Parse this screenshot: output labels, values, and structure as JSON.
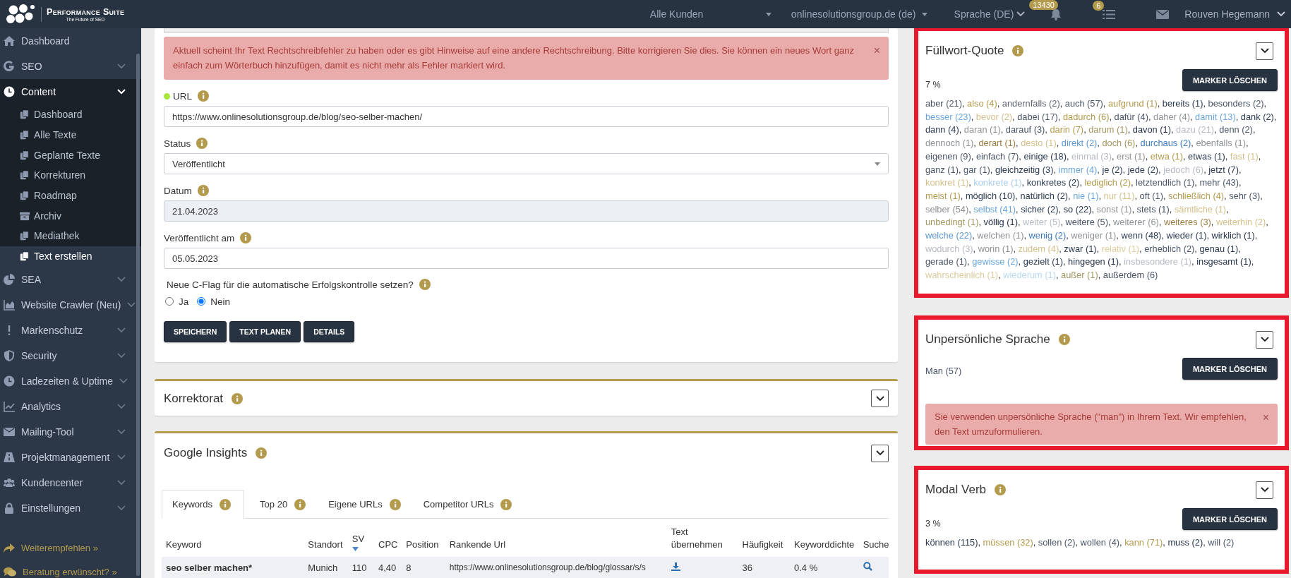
{
  "topbar": {
    "brand": "Performance Suite",
    "tagline": "The Future of SEO",
    "customer": "Alle Kunden",
    "domain": "onlinesolutionsgroup.de (de)",
    "language": "Sprache (DE)",
    "notifications_badge": "13430",
    "tasks_badge": "6",
    "user": "Rouven Hegemann"
  },
  "sidebar": {
    "items": [
      {
        "label": "Dashboard",
        "expandable": false,
        "expanded": false
      },
      {
        "label": "SEO",
        "expandable": true,
        "expanded": false
      },
      {
        "label": "Content",
        "expandable": true,
        "expanded": true,
        "children": [
          {
            "label": "Dashboard",
            "selected": false
          },
          {
            "label": "Alle Texte",
            "selected": false
          },
          {
            "label": "Geplante Texte",
            "selected": false
          },
          {
            "label": "Korrekturen",
            "selected": false
          },
          {
            "label": "Roadmap",
            "selected": false
          },
          {
            "label": "Archiv",
            "selected": false
          },
          {
            "label": "Mediathek",
            "selected": false
          },
          {
            "label": "Text erstellen",
            "selected": true
          }
        ]
      },
      {
        "label": "SEA",
        "expandable": true,
        "expanded": false
      },
      {
        "label": "Website Crawler (Neu)",
        "expandable": true,
        "expanded": false
      },
      {
        "label": "Markenschutz",
        "expandable": true,
        "expanded": false
      },
      {
        "label": "Security",
        "expandable": true,
        "expanded": false
      },
      {
        "label": "Ladezeiten & Uptime",
        "expandable": true,
        "expanded": false
      },
      {
        "label": "Analytics",
        "expandable": true,
        "expanded": false
      },
      {
        "label": "Mailing-Tool",
        "expandable": true,
        "expanded": false
      },
      {
        "label": "Projektmanagement",
        "expandable": true,
        "expanded": false
      },
      {
        "label": "Kundencenter",
        "expandable": true,
        "expanded": false
      },
      {
        "label": "Einstellungen",
        "expandable": true,
        "expanded": false
      }
    ],
    "footer_links": [
      "Weiterempfehlen »",
      "Beratung erwünscht? »"
    ]
  },
  "form": {
    "alert": {
      "text": "Aktuell scheint Ihr Text Rechtschreibfehler zu haben oder es gibt Hinweise auf eine andere Rechtschreibung. Bitte korrigieren Sie dies. Sie können ein neues Wort ganz einfach zum Wörterbuch hinzufügen, damit es nicht mehr als Fehler markiert wird.",
      "close": "×"
    },
    "fields": [
      {
        "label": "URL",
        "kind": "text",
        "value": "https://www.onlinesolutionsgroup.de/blog/seo-selber-machen/",
        "disabled": false,
        "color": "#a8e63a"
      },
      {
        "label": "Status",
        "kind": "select",
        "value": "Veröffentlicht",
        "disabled": false
      },
      {
        "label": "Datum",
        "kind": "text",
        "value": "21.04.2023",
        "disabled": true
      },
      {
        "label": "Veröffentlicht am",
        "kind": "text",
        "value": "05.05.2023",
        "disabled": false
      }
    ],
    "question": {
      "label": "Neue C-Flag für die automatische Erfolgskontrolle setzen?",
      "options": [
        {
          "label": "Ja",
          "selected": false
        },
        {
          "label": "Nein",
          "selected": true
        }
      ]
    },
    "buttons": [
      "SPEICHERN",
      "TEXT PLANEN",
      "DETAILS"
    ]
  },
  "korrektorat": {
    "title": "Korrektorat"
  },
  "google_insights": {
    "title": "Google Insights",
    "tabs": [
      {
        "label": "Keywords",
        "selected": true
      },
      {
        "label": "Top 20",
        "selected": false
      },
      {
        "label": "Eigene URLs",
        "selected": false
      },
      {
        "label": "Competitor URLs",
        "selected": false
      }
    ],
    "table": {
      "columns": [
        {
          "label": "Keyword",
          "sorted": false
        },
        {
          "label": "Standort",
          "sorted": false
        },
        {
          "label": "SV",
          "sorted": true
        },
        {
          "label": "CPC",
          "sorted": false
        },
        {
          "label": "Position",
          "sorted": false
        },
        {
          "label": "Rankende Url",
          "sorted": false
        },
        {
          "label": "Text übernehmen",
          "sorted": false
        },
        {
          "label": "Häufigkeit",
          "sorted": false
        },
        {
          "label": "Keyworddichte",
          "sorted": false
        },
        {
          "label": "Suche",
          "sorted": false
        }
      ],
      "rows": [
        {
          "cells": [
            {
              "kind": "text",
              "text": "seo selber machen*"
            },
            {
              "kind": "text",
              "text": "Munich"
            },
            {
              "kind": "text",
              "text": "110"
            },
            {
              "kind": "text",
              "text": "4,40"
            },
            {
              "kind": "text",
              "text": "8"
            },
            {
              "kind": "text",
              "text": "https://www.onlinesolutionsgroup.de/blog/glossar/s/s"
            },
            {
              "kind": "download"
            },
            {
              "kind": "text",
              "text": "36"
            },
            {
              "kind": "text",
              "text": "0.4 %"
            },
            {
              "kind": "search"
            }
          ]
        }
      ]
    }
  },
  "word_separator": ",",
  "analysis_cards": [
    {
      "title": "Füllwort-Quote",
      "button": "MARKER LÖSCHEN",
      "percent": "7 %",
      "words": [
        {
          "text": "aber (21)",
          "color": "#4a5568"
        },
        {
          "text": "also (4)",
          "color": "#b39a4c"
        },
        {
          "text": "andernfalls (2)",
          "color": "#5f6673"
        },
        {
          "text": "auch (57)",
          "color": "#4a5568"
        },
        {
          "text": "aufgrund (1)",
          "color": "#b39a4c"
        },
        {
          "text": "bereits (1)",
          "color": "#2a3a52"
        },
        {
          "text": "besonders (2)",
          "color": "#4a5568"
        },
        {
          "text": "besser (23)",
          "color": "#6aa6dc"
        },
        {
          "text": "bevor (2)",
          "color": "#d4bf8a"
        },
        {
          "text": "dabei (17)",
          "color": "#4a5568"
        },
        {
          "text": "dadurch (6)",
          "color": "#b39a4c"
        },
        {
          "text": "dafür (4)",
          "color": "#4a5568"
        },
        {
          "text": "daher (4)",
          "color": "#8e9196"
        },
        {
          "text": "damit (13)",
          "color": "#6aa6dc"
        },
        {
          "text": "dank (2)",
          "color": "#2a3a52"
        },
        {
          "text": "dann (4)",
          "color": "#2a3a52"
        },
        {
          "text": "daran (1)",
          "color": "#8e9196"
        },
        {
          "text": "darauf (3)",
          "color": "#4a5568"
        },
        {
          "text": "darin (7)",
          "color": "#b39a4c"
        },
        {
          "text": "darum (1)",
          "color": "#a39660"
        },
        {
          "text": "davon (1)",
          "color": "#1f2d45"
        },
        {
          "text": "dazu (21)",
          "color": "#b7bac4"
        },
        {
          "text": "denn (2)",
          "color": "#4a5568"
        },
        {
          "text": "dennoch (1)",
          "color": "#8e9196"
        },
        {
          "text": "derart (1)",
          "color": "#9a7a40"
        },
        {
          "text": "desto (1)",
          "color": "#d4bf8a"
        },
        {
          "text": "direkt (2)",
          "color": "#5a96d0"
        },
        {
          "text": "doch (6)",
          "color": "#a39660"
        },
        {
          "text": "durchaus (2)",
          "color": "#3b7bbd"
        },
        {
          "text": "ebenfalls (1)",
          "color": "#8e9196"
        },
        {
          "text": "eigenen (9)",
          "color": "#4a5568"
        },
        {
          "text": "einfach (7)",
          "color": "#4a5568"
        },
        {
          "text": "einige (18)",
          "color": "#2a3a52"
        },
        {
          "text": "einmal (3)",
          "color": "#b7bac4"
        },
        {
          "text": "erst (1)",
          "color": "#8e9196"
        },
        {
          "text": "etwa (1)",
          "color": "#b39a4c"
        },
        {
          "text": "etwas (1)",
          "color": "#2a3a52"
        },
        {
          "text": "fast (1)",
          "color": "#d4bf8a"
        },
        {
          "text": "ganz (1)",
          "color": "#4a5568"
        },
        {
          "text": "gar (1)",
          "color": "#4a5568"
        },
        {
          "text": "gleichzeitig (3)",
          "color": "#2a3a52"
        },
        {
          "text": "immer (4)",
          "color": "#6aa6dc"
        },
        {
          "text": "je (2)",
          "color": "#2a3a52"
        },
        {
          "text": "jede (2)",
          "color": "#2a3a52"
        },
        {
          "text": "jedoch (6)",
          "color": "#b7bac4"
        },
        {
          "text": "jetzt (7)",
          "color": "#2a3a52"
        },
        {
          "text": "konkret (1)",
          "color": "#d4bf8a"
        },
        {
          "text": "konkrete (1)",
          "color": "#a9cdee"
        },
        {
          "text": "konkretes (2)",
          "color": "#2a3a52"
        },
        {
          "text": "lediglich (2)",
          "color": "#b39a4c"
        },
        {
          "text": "letztendlich (1)",
          "color": "#4a5568"
        },
        {
          "text": "mehr (43)",
          "color": "#4a5568"
        },
        {
          "text": "meist (1)",
          "color": "#b39a4c"
        },
        {
          "text": "möglich (10)",
          "color": "#2a3a52"
        },
        {
          "text": "natürlich (2)",
          "color": "#2a3a52"
        },
        {
          "text": "nie (1)",
          "color": "#6aa6dc"
        },
        {
          "text": "nur (11)",
          "color": "#d4bf8a"
        },
        {
          "text": "oft (1)",
          "color": "#4a5568"
        },
        {
          "text": "schließlich (4)",
          "color": "#b39a4c"
        },
        {
          "text": "sehr (3)",
          "color": "#4a5568"
        },
        {
          "text": "selber (54)",
          "color": "#8e9196"
        },
        {
          "text": "selbst (41)",
          "color": "#6aa6dc"
        },
        {
          "text": "sicher (2)",
          "color": "#2a3a52"
        },
        {
          "text": "so (22)",
          "color": "#1f2d45"
        },
        {
          "text": "sonst (1)",
          "color": "#8e9196"
        },
        {
          "text": "stets (1)",
          "color": "#4a5568"
        },
        {
          "text": "sämtliche (1)",
          "color": "#d4bf8a"
        },
        {
          "text": "unbedingt (1)",
          "color": "#a39660"
        },
        {
          "text": "völlig (1)",
          "color": "#1f2d45"
        },
        {
          "text": "weiter (5)",
          "color": "#b7bac4"
        },
        {
          "text": "weitere (5)",
          "color": "#4a5568"
        },
        {
          "text": "weiterer (6)",
          "color": "#8e9196"
        },
        {
          "text": "weiteres (3)",
          "color": "#9a7a40"
        },
        {
          "text": "weiterhin (2)",
          "color": "#d4bf8a"
        },
        {
          "text": "welche (22)",
          "color": "#5a96d0"
        },
        {
          "text": "welchen (1)",
          "color": "#8e9196"
        },
        {
          "text": "wenig (2)",
          "color": "#3b7bbd"
        },
        {
          "text": "weniger (1)",
          "color": "#8e9196"
        },
        {
          "text": "wenn (48)",
          "color": "#2a3a52"
        },
        {
          "text": "wieder (1)",
          "color": "#2a3a52"
        },
        {
          "text": "wirklich (1)",
          "color": "#1f2d45"
        },
        {
          "text": "wodurch (3)",
          "color": "#b7bac4"
        },
        {
          "text": "worin (1)",
          "color": "#8e9196"
        },
        {
          "text": "zudem (4)",
          "color": "#d4bf8a"
        },
        {
          "text": "zwar (1)",
          "color": "#2a3a52"
        },
        {
          "text": "relativ (1)",
          "color": "#ddcb9c"
        },
        {
          "text": "erheblich (2)",
          "color": "#4a5568"
        },
        {
          "text": "genau (1)",
          "color": "#2a3a52"
        },
        {
          "text": "gerade (1)",
          "color": "#4a5568"
        },
        {
          "text": "gewisse (2)",
          "color": "#6aa6dc"
        },
        {
          "text": "gezielt (1)",
          "color": "#2a3a52"
        },
        {
          "text": "hingegen (1)",
          "color": "#1f2d45"
        },
        {
          "text": "insbesondere (1)",
          "color": "#b7bac4"
        },
        {
          "text": "insgesamt (1)",
          "color": "#1f2d45"
        },
        {
          "text": "wahrscheinlich (1)",
          "color": "#ddcb9c"
        },
        {
          "text": "wiederum (1)",
          "color": "#b8d8f2"
        },
        {
          "text": "außer (1)",
          "color": "#a39660"
        },
        {
          "text": "außerdem (6)",
          "color": "#4a5568"
        }
      ]
    },
    {
      "title": "Unpersönliche Sprache",
      "button": "MARKER LÖSCHEN",
      "words": [
        {
          "text": "Man (57)",
          "color": "#4a5568"
        }
      ],
      "alert": {
        "text": "Sie verwenden unpersönliche Sprache (\"man\") in Ihrem Text. Wir empfehlen, den Text umzuformulieren.",
        "close": "×"
      }
    },
    {
      "title": "Modal Verb",
      "button": "MARKER LÖSCHEN",
      "percent": "3 %",
      "words": [
        {
          "text": "können (115)",
          "color": "#2a3a52"
        },
        {
          "text": "müssen (32)",
          "color": "#b39a4c"
        },
        {
          "text": "sollen (2)",
          "color": "#4a5568"
        },
        {
          "text": "wollen (4)",
          "color": "#4a5568"
        },
        {
          "text": "kann (71)",
          "color": "#b39a4c"
        },
        {
          "text": "muss (2)",
          "color": "#1f2d45"
        },
        {
          "text": "will (2)",
          "color": "#4a5568"
        }
      ]
    }
  ]
}
